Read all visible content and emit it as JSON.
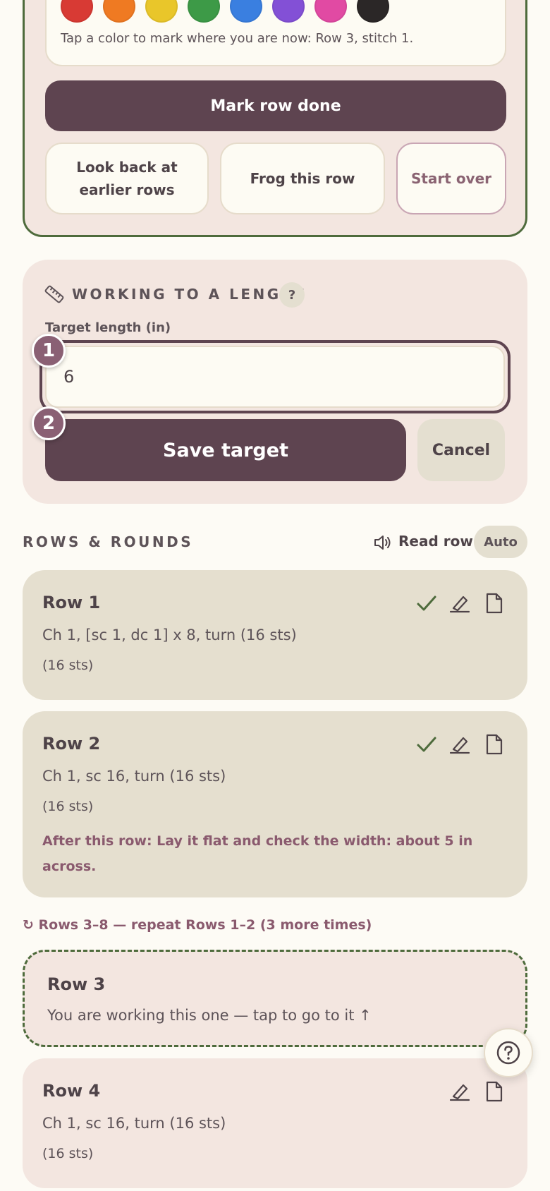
{
  "colors": {
    "swatches": [
      "#d83a34",
      "#ef7a22",
      "#e9c62a",
      "#3d9a47",
      "#3a7fe0",
      "#8350d6",
      "#e14aa3",
      "#2b2727"
    ],
    "hint": "Tap a color to mark where you are now: Row 3, stitch 1."
  },
  "actions": {
    "mark_done": "Mark row done",
    "look_back": "Look back at earlier rows",
    "frog": "Frog this row",
    "start_over": "Start over"
  },
  "length": {
    "title": "WORKING TO A LENGTH",
    "help": "?",
    "target_label": "Target length (in)",
    "target_value": "6",
    "step1": "1",
    "step2": "2",
    "save": "Save target",
    "cancel": "Cancel"
  },
  "rows_header": {
    "title": "ROWS & ROUNDS",
    "read_row": "Read row",
    "auto": "Auto"
  },
  "rows": [
    {
      "title": "Row 1",
      "instruction": "Ch 1, [sc 1, dc 1] x 8, turn (16 sts)",
      "sts": "(16 sts)",
      "done": true
    },
    {
      "title": "Row 2",
      "instruction": "Ch 1, sc 16, turn (16 sts)",
      "sts": "(16 sts)",
      "note": "After this row: Lay it flat and check the width: about 5 in across.",
      "done": true
    },
    {
      "title": "Row 4",
      "instruction": "Ch 1, sc 16, turn (16 sts)",
      "sts": "(16 sts)",
      "done": false
    }
  ],
  "repeat_note": "↻ Rows 3–8 — repeat Rows 1–2 (3 more times)",
  "current_row": {
    "title": "Row 3",
    "hint": "You are working this one — tap to go to it ↑"
  },
  "icons": {
    "ruler": "ruler-icon",
    "speaker": "speaker-icon",
    "check": "check-icon",
    "highlighter": "highlighter-icon",
    "note": "note-icon",
    "help": "help-circle-icon"
  }
}
